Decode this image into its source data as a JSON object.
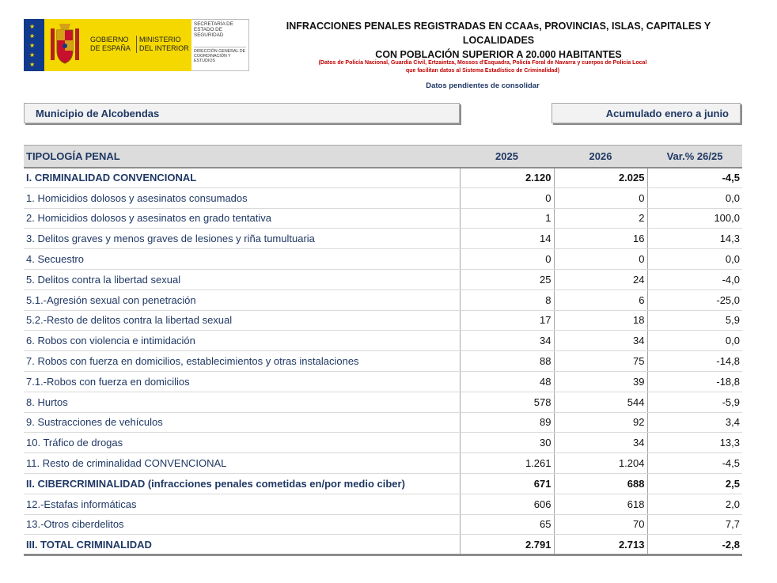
{
  "header": {
    "logo_text_1": "GOBIERNO DE ESPAÑA",
    "logo_text_2": "MINISTERIO DEL INTERIOR",
    "logo_secretaria": "SECRETARÍA DE ESTADO DE SEGURIDAD",
    "logo_direccion": "DIRECCIÓN GENERAL DE COORDINACIÓN Y ESTUDIOS",
    "title_line1": "INFRACCIONES PENALES REGISTRADAS EN CCAAs, PROVINCIAS, ISLAS, CAPITALES Y LOCALIDADES",
    "title_line2": "CON POBLACIÓN SUPERIOR A 20.000 HABITANTES",
    "subtitle_red_1": "(Datos de Policía Nacional, Guardia Civil, Ertzaintza, Mossos d'Esquadra, Policía Foral de Navarra y cuerpos de Policía Local",
    "subtitle_red_2": "que facilitan datos al Sistema Estadístico de Criminalidad)",
    "subtitle_blue": "Datos pendientes de consolidar"
  },
  "municipality": "Municipio de Alcobendas",
  "period": "Acumulado enero a junio",
  "table": {
    "headers": [
      "TIPOLOGÍA PENAL",
      "2025",
      "2026",
      "Var.% 26/25"
    ],
    "rows": [
      {
        "label": "I. CRIMINALIDAD CONVENCIONAL",
        "v2025": "2.120",
        "v2026": "2.025",
        "var": "-4,5",
        "bold": true
      },
      {
        "label": "1. Homicidios dolosos y asesinatos consumados",
        "v2025": "0",
        "v2026": "0",
        "var": "0,0",
        "bold": false
      },
      {
        "label": "2. Homicidios dolosos y asesinatos en grado tentativa",
        "v2025": "1",
        "v2026": "2",
        "var": "100,0",
        "bold": false
      },
      {
        "label": "3. Delitos graves y menos graves de lesiones y riña tumultuaria",
        "v2025": "14",
        "v2026": "16",
        "var": "14,3",
        "bold": false
      },
      {
        "label": "4. Secuestro",
        "v2025": "0",
        "v2026": "0",
        "var": "0,0",
        "bold": false
      },
      {
        "label": "5. Delitos contra la libertad sexual",
        "v2025": "25",
        "v2026": "24",
        "var": "-4,0",
        "bold": false
      },
      {
        "label": "5.1.-Agresión sexual con penetración",
        "v2025": "8",
        "v2026": "6",
        "var": "-25,0",
        "bold": false
      },
      {
        "label": "5.2.-Resto de delitos contra la libertad sexual",
        "v2025": "17",
        "v2026": "18",
        "var": "5,9",
        "bold": false
      },
      {
        "label": "6. Robos con violencia e intimidación",
        "v2025": "34",
        "v2026": "34",
        "var": "0,0",
        "bold": false
      },
      {
        "label": "7. Robos con fuerza en domicilios, establecimientos y otras instalaciones",
        "v2025": "88",
        "v2026": "75",
        "var": "-14,8",
        "bold": false
      },
      {
        "label": "7.1.-Robos con fuerza en domicilios",
        "v2025": "48",
        "v2026": "39",
        "var": "-18,8",
        "bold": false
      },
      {
        "label": "8. Hurtos",
        "v2025": "578",
        "v2026": "544",
        "var": "-5,9",
        "bold": false
      },
      {
        "label": "9. Sustracciones de vehículos",
        "v2025": "89",
        "v2026": "92",
        "var": "3,4",
        "bold": false
      },
      {
        "label": "10. Tráfico de drogas",
        "v2025": "30",
        "v2026": "34",
        "var": "13,3",
        "bold": false
      },
      {
        "label": "11. Resto de criminalidad CONVENCIONAL",
        "v2025": "1.261",
        "v2026": "1.204",
        "var": "-4,5",
        "bold": false
      },
      {
        "label": "II. CIBERCRIMINALIDAD (infracciones penales cometidas en/por medio ciber)",
        "v2025": "671",
        "v2026": "688",
        "var": "2,5",
        "bold": true
      },
      {
        "label": "12.-Estafas informáticas",
        "v2025": "606",
        "v2026": "618",
        "var": "2,0",
        "bold": false
      },
      {
        "label": "13.-Otros ciberdelitos",
        "v2025": "65",
        "v2026": "70",
        "var": "7,7",
        "bold": false
      },
      {
        "label": "III. TOTAL CRIMINALIDAD",
        "v2025": "2.791",
        "v2026": "2.713",
        "var": "-2,8",
        "bold": true
      }
    ]
  }
}
